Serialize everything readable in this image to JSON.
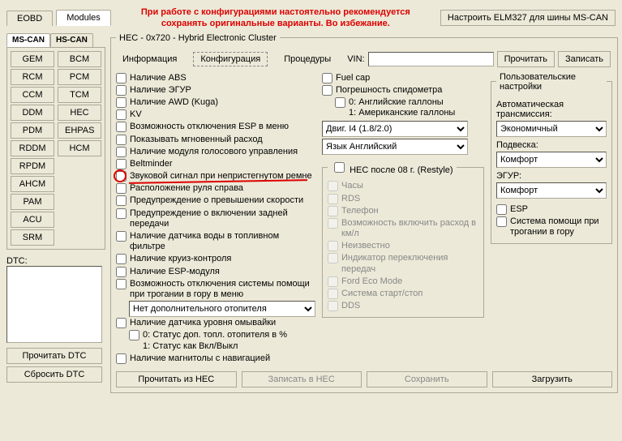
{
  "topTabs": {
    "eobd": "EOBD",
    "modules": "Modules"
  },
  "warning": "При работе с конфигурациями настоятельно рекомендуется сохранять оригинальные варианты. Во избежание.",
  "elmBtn": "Настроить ELM327 для шины MS-CAN",
  "sideTabs": {
    "ms": "MS-CAN",
    "hs": "HS-CAN"
  },
  "sideCol1": [
    "GEM",
    "RCM",
    "CCM",
    "DDM",
    "PDM",
    "RDDM",
    "RPDM",
    "AHCM",
    "PAM",
    "ACU",
    "SRM"
  ],
  "sideCol2": [
    "BCM",
    "PCM",
    "TCM",
    "HEC",
    "EHPAS",
    "HCM"
  ],
  "dtcLabel": "DTC:",
  "dtcRead": "Прочитать DTC",
  "dtcReset": "Сбросить DTC",
  "panelTitle": "HEC - 0x720 - Hybrid Electronic Cluster",
  "panelTabs": {
    "info": "Информация",
    "config": "Конфигурация",
    "proc": "Процедуры"
  },
  "vinLabel": "VIN:",
  "vinValue": "",
  "readBtn": "Прочитать",
  "writeBtn": "Записать",
  "checks1": [
    "Наличие ABS",
    "Наличие ЭГУР",
    "Наличие AWD (Kuga)",
    "KV",
    "Возможность отключения ESP в меню",
    "Показывать мгновенный расход",
    "Наличие модуля голосового управления",
    "Beltminder",
    "Звуковой сигнал при непристегнутом ремне",
    "Расположение руля справа",
    "Предупреждение о превышении скорости",
    "Предупреждение о включении задней передачи",
    "Наличие датчика воды в топливном фильтре",
    "Наличие круиз-контроля",
    "Наличие ESP-модуля",
    "Возможность отключения системы помощи при трогании в гору в меню"
  ],
  "heaterCombo": "Нет дополнительного отопителя",
  "checks1b": [
    "Наличие датчика уровня омывайки",
    "0: Статус доп. топл. отопителя в %\n1: Статус как Вкл/Выкл",
    "Наличие магнитолы с навигацией"
  ],
  "checks2": [
    "Fuel cap",
    "Погрешность спидометра",
    "0: Английские галлоны\n1: Американские галлоны"
  ],
  "engineCombo": "Двиг. I4 (1.8/2.0)",
  "langCombo": "Язык Английский",
  "restyleTitle": "HEC после 08 г. (Restyle)",
  "restyleChecks": [
    "Часы",
    "RDS",
    "Телефон",
    "Возможность включить расход в км/л",
    "Неизвестно",
    "Индикатор переключения передач",
    "Ford Eco Mode",
    "Система старт/стоп",
    "DDS"
  ],
  "userTitle": "Пользовательские настройки",
  "userTrans": "Автоматическая трансмиссия:",
  "userTransVal": "Экономичный",
  "userSusp": "Подвеска:",
  "userSuspVal": "Комфорт",
  "userEgur": "ЭГУР:",
  "userEgurVal": "Комфорт",
  "userEsp": "ESP",
  "userHill": "Система помощи при трогании в гору",
  "bottom": {
    "read": "Прочитать из HEC",
    "write": "Записать в HEC",
    "save": "Сохранить",
    "load": "Загрузить"
  }
}
